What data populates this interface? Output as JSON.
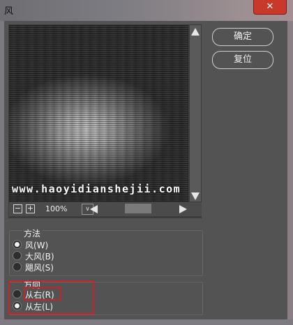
{
  "window": {
    "title": "风",
    "close_glyph": "✕"
  },
  "preview": {
    "watermark": "www.haoyidianshejii.com"
  },
  "zoom": {
    "minus": "−",
    "plus": "+",
    "value": "100%",
    "dropdown": "∨"
  },
  "buttons": {
    "ok": "确定",
    "reset": "复位"
  },
  "method": {
    "label": "方法",
    "options": [
      "风(W)",
      "大风(B)",
      "飓风(S)"
    ],
    "selected": 0
  },
  "direction": {
    "label": "方向",
    "options": [
      "从右(R)",
      "从左(L)"
    ],
    "selected": 1
  },
  "highlight_color": "#c8232a"
}
